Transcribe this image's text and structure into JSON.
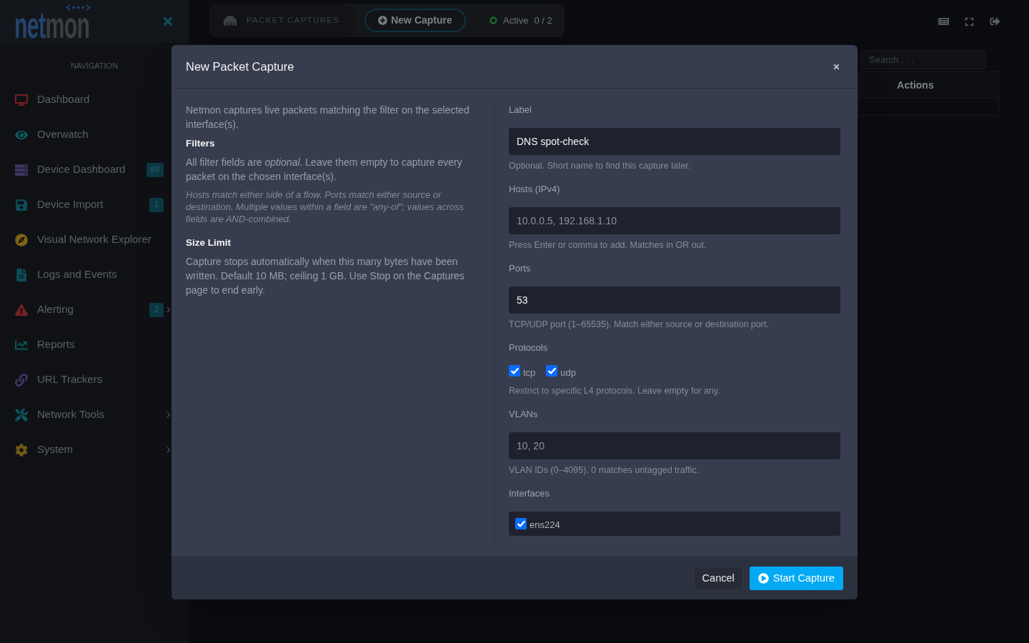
{
  "logo": {
    "text_1": "net",
    "text_2": "mon"
  },
  "sidebar": {
    "heading": "NAVIGATION",
    "items": [
      {
        "label": "Dashboard",
        "kind": "monitor",
        "submenu": false
      },
      {
        "label": "Overwatch",
        "kind": "eye",
        "submenu": false
      },
      {
        "label": "Device Dashboard",
        "kind": "servers",
        "badge": "89",
        "submenu": false
      },
      {
        "label": "Device Import",
        "kind": "floppy",
        "badge": "1",
        "submenu": false
      },
      {
        "label": "Visual Network Explorer",
        "kind": "compass",
        "submenu": false
      },
      {
        "label": "Logs and Events",
        "kind": "document",
        "submenu": false
      },
      {
        "label": "Alerting",
        "kind": "warning",
        "badge": "2",
        "submenu": true
      },
      {
        "label": "Reports",
        "kind": "chart",
        "submenu": false
      },
      {
        "label": "URL Trackers",
        "kind": "link",
        "submenu": false
      },
      {
        "label": "Network Tools",
        "kind": "tools",
        "submenu": true
      },
      {
        "label": "System",
        "kind": "gear",
        "submenu": true
      }
    ]
  },
  "top_bar": {
    "section": "PACKET CAPTURES",
    "new_button": "New Capture",
    "active_label": "Active",
    "active_count": "0 / 2"
  },
  "background_table": {
    "search_placeholder": "Search . . .",
    "column": "Actions"
  },
  "modal": {
    "title": "New Packet Capture",
    "info": [
      {
        "kind": "paragraph",
        "text": "Netmon captures live packets matching the filter on the selected interface(s)."
      },
      {
        "kind": "heading",
        "text": "Filters"
      },
      {
        "kind": "paragraph",
        "text": "All filter fields are *optional*. Leave them empty to capture every packet on the chosen interface(s)."
      },
      {
        "kind": "note",
        "text": "Hosts match either side of a flow. Ports match either source or destination. Multiple values within a field are \"any-of\"; values across fields are AND-combined."
      },
      {
        "kind": "heading",
        "text": "Size Limit"
      },
      {
        "kind": "paragraph",
        "text": "Capture stops automatically when this many bytes have been written. Default 10 MB; ceiling 1 GB. Use Stop on the Captures page to end early."
      }
    ],
    "fields": [
      {
        "kind": "text",
        "label": "Label",
        "value": "DNS spot-check",
        "help": "Optional. Short name to find this capture later."
      },
      {
        "kind": "text",
        "label": "Hosts (IPv4)",
        "placeholder": "10.0.0.5, 192.168.1.10",
        "help": "Press Enter or comma to add. Matches in OR out."
      },
      {
        "kind": "text",
        "label": "Ports",
        "value": "53",
        "help": "TCP/UDP port (1–65535). Match either source or destination port."
      },
      {
        "kind": "checks",
        "label": "Protocols",
        "options": [
          {
            "label": "tcp",
            "checked": true
          },
          {
            "label": "udp",
            "checked": true
          }
        ],
        "help": "Restrict to specific L4 protocols. Leave empty for any."
      },
      {
        "kind": "text",
        "label": "VLANs",
        "placeholder": "10, 20",
        "help": "VLAN IDs (0–4095). 0 matches untagged traffic."
      },
      {
        "kind": "checklist",
        "label": "Interfaces",
        "options": [
          {
            "label": "ens224",
            "checked": true
          }
        ]
      }
    ],
    "buttons": [
      {
        "label": "Cancel",
        "kind": "secondary"
      },
      {
        "label": "Start Capture",
        "kind": "primary"
      }
    ]
  }
}
